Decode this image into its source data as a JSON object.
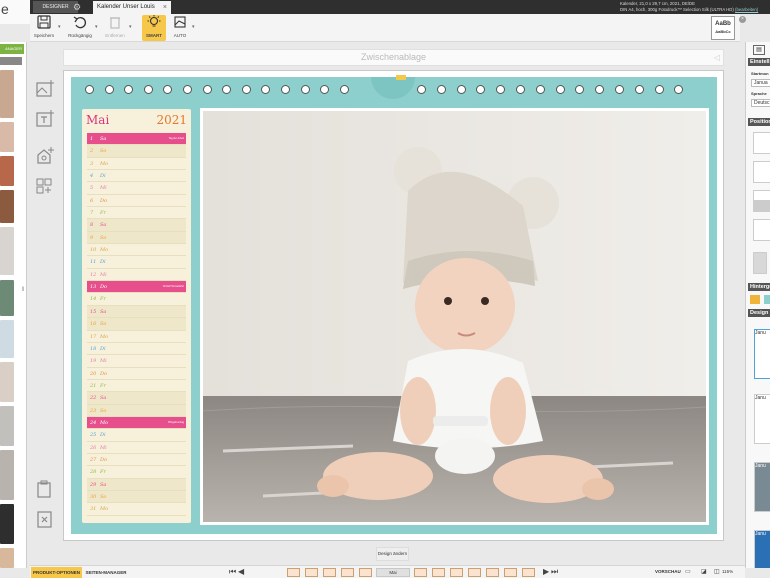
{
  "app": {
    "brand_text": "e",
    "designer_tab": "DESIGNER",
    "settings_icon": "gear-icon",
    "document_tab": "Kalender Unser Louis",
    "close_glyph": "×"
  },
  "product_info": {
    "line1": "Kalender, 21,0 x 29,7 cm, 2021, DE/DE",
    "line2": "DIN A4, hoch, 300g Fotodruck™ Selection Silk (ULTRA HD)",
    "change_link": "(bearbeiten)"
  },
  "toolbar": {
    "save_label": "Speichern",
    "undo_label": "Rückgängig",
    "remove_label": "Entfernen",
    "smart_label": "SMART",
    "auto_label": "AUTO",
    "preview_text_1": "AaBb",
    "preview_text_2": "AaBbCc",
    "preview_close": "×"
  },
  "left_panel": {
    "manager_label": "ANAGER",
    "collapse": "‖"
  },
  "canvas": {
    "clipboard_label": "Zwischenablage",
    "clipboard_arrow": "◁",
    "month": "Mai",
    "year": "2021",
    "days": [
      {
        "n": "1",
        "w": "Sa",
        "note": "Tag der Arbeit",
        "type": "pink"
      },
      {
        "n": "2",
        "w": "So",
        "note": "",
        "type": "we"
      },
      {
        "n": "3",
        "w": "Mo",
        "note": "",
        "type": ""
      },
      {
        "n": "4",
        "w": "Di",
        "note": "",
        "type": ""
      },
      {
        "n": "5",
        "w": "Mi",
        "note": "",
        "type": ""
      },
      {
        "n": "6",
        "w": "Do",
        "note": "",
        "type": ""
      },
      {
        "n": "7",
        "w": "Fr",
        "note": "",
        "type": ""
      },
      {
        "n": "8",
        "w": "Sa",
        "note": "",
        "type": "we"
      },
      {
        "n": "9",
        "w": "So",
        "note": "",
        "type": "we"
      },
      {
        "n": "10",
        "w": "Mo",
        "note": "",
        "type": ""
      },
      {
        "n": "11",
        "w": "Di",
        "note": "",
        "type": ""
      },
      {
        "n": "12",
        "w": "Mi",
        "note": "",
        "type": ""
      },
      {
        "n": "13",
        "w": "Do",
        "note": "Christi Himmelfahrt",
        "type": "pink"
      },
      {
        "n": "14",
        "w": "Fr",
        "note": "",
        "type": ""
      },
      {
        "n": "15",
        "w": "Sa",
        "note": "",
        "type": "we"
      },
      {
        "n": "16",
        "w": "So",
        "note": "",
        "type": "we"
      },
      {
        "n": "17",
        "w": "Mo",
        "note": "",
        "type": ""
      },
      {
        "n": "18",
        "w": "Di",
        "note": "",
        "type": ""
      },
      {
        "n": "19",
        "w": "Mi",
        "note": "",
        "type": ""
      },
      {
        "n": "20",
        "w": "Do",
        "note": "",
        "type": ""
      },
      {
        "n": "21",
        "w": "Fr",
        "note": "",
        "type": ""
      },
      {
        "n": "22",
        "w": "Sa",
        "note": "",
        "type": "we"
      },
      {
        "n": "23",
        "w": "So",
        "note": "",
        "type": "we"
      },
      {
        "n": "24",
        "w": "Mo",
        "note": "Pfingstmontag",
        "type": "pink"
      },
      {
        "n": "25",
        "w": "Di",
        "note": "",
        "type": ""
      },
      {
        "n": "26",
        "w": "Mi",
        "note": "",
        "type": ""
      },
      {
        "n": "27",
        "w": "Do",
        "note": "",
        "type": ""
      },
      {
        "n": "28",
        "w": "Fr",
        "note": "",
        "type": ""
      },
      {
        "n": "29",
        "w": "Sa",
        "note": "",
        "type": "we"
      },
      {
        "n": "30",
        "w": "So",
        "note": "",
        "type": "we"
      },
      {
        "n": "31",
        "w": "Mo",
        "note": "",
        "type": ""
      }
    ],
    "day_colors": [
      "#e64f8c",
      "#e8a23a",
      "#d4a64a",
      "#5aa5d6",
      "#e27fa8",
      "#e0934a",
      "#8bbf4a"
    ]
  },
  "right_panel": {
    "settings_head": "Einstell",
    "start_month_label": "Startmon",
    "start_month_value": "Janua",
    "language_label": "Sprache",
    "language_value": "Deutsc",
    "position_head": "Position",
    "background_head": "Hintergr",
    "design_head": "Design (",
    "swatch_colors": [
      "#f0b43a",
      "#8ccfcd"
    ],
    "design_thumb_1": "Janu",
    "design_thumb_2": "Janu",
    "design_thumb_3": "Janu",
    "design_thumb_4": "Janu"
  },
  "bottom": {
    "design_change": "Design ändern",
    "product_options": "PRODUKT-OPTIONEN",
    "pages_manager": "SEITEN-MANAGER",
    "month_pill": "Mai",
    "preview": "VORSCHAU",
    "zoom": "115%"
  }
}
